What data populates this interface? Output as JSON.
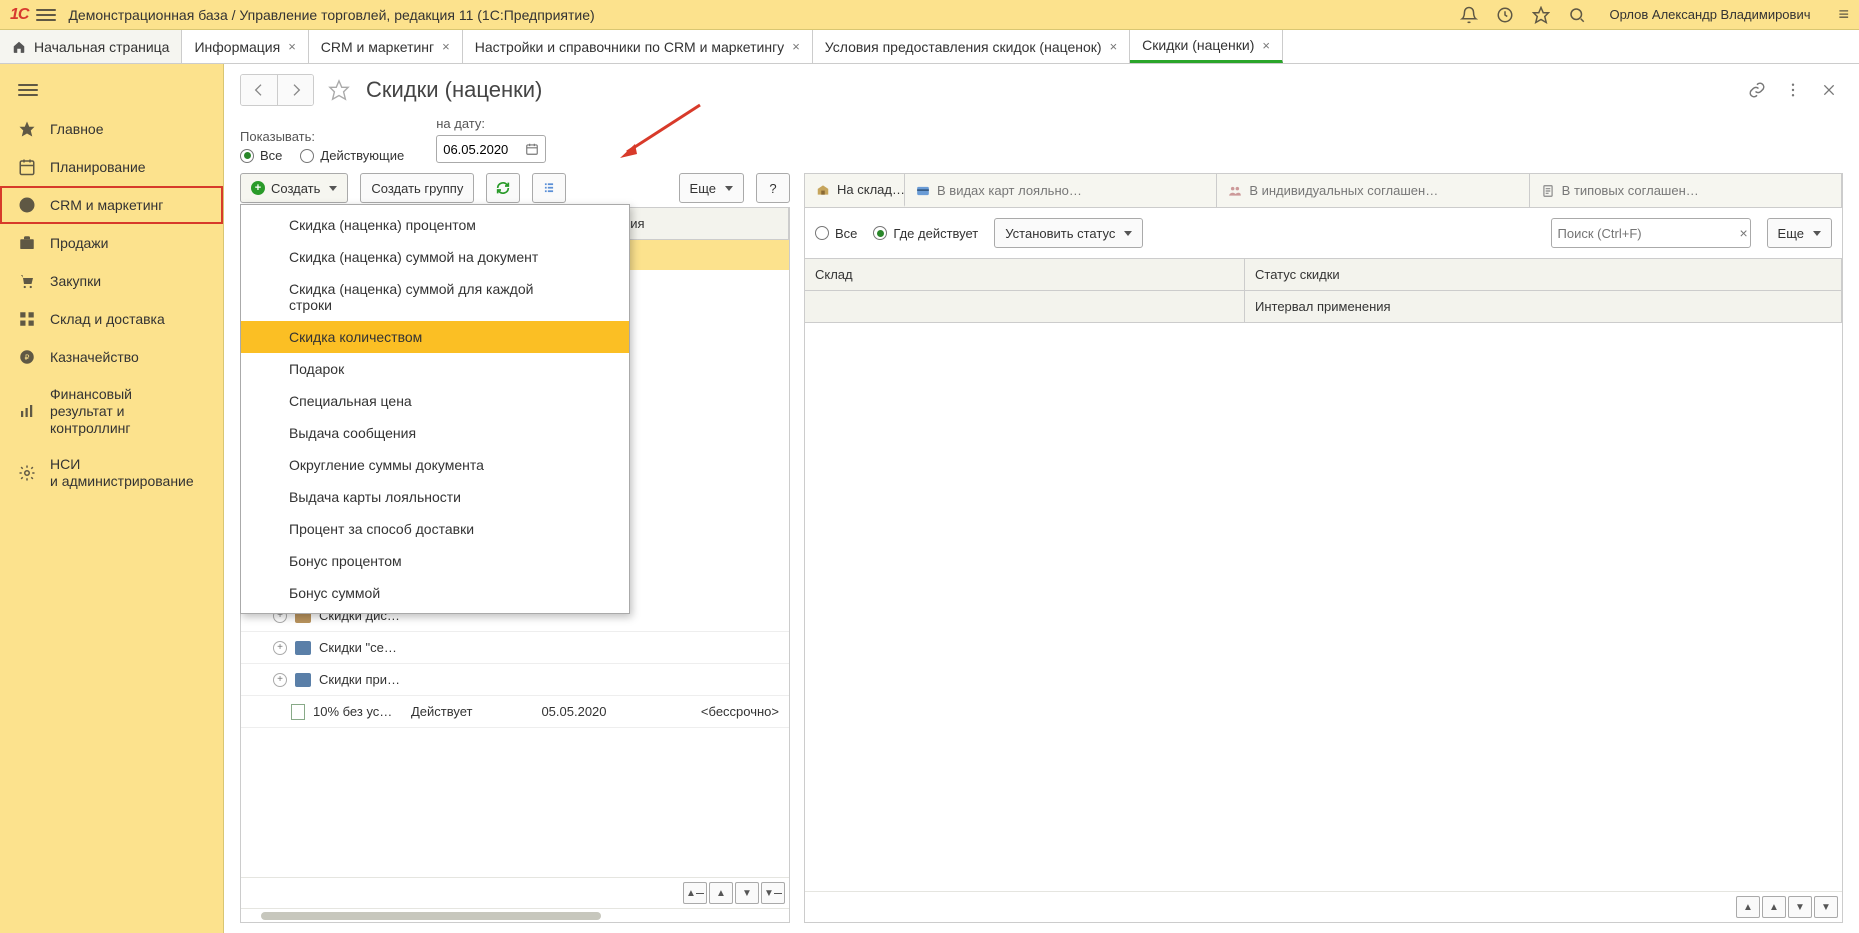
{
  "titlebar": {
    "app_title": "Демонстрационная база / Управление торговлей, редакция 11   (1С:Предприятие)",
    "user_name": "Орлов Александр Владимирович"
  },
  "tabs": [
    {
      "label": "Начальная страница",
      "closable": false,
      "active": false,
      "home": true
    },
    {
      "label": "Информация",
      "closable": true,
      "active": false
    },
    {
      "label": "CRM и маркетинг",
      "closable": true,
      "active": false
    },
    {
      "label": "Настройки и справочники по CRM и маркетингу",
      "closable": true,
      "active": false
    },
    {
      "label": "Условия предоставления скидок (наценок)",
      "closable": true,
      "active": false
    },
    {
      "label": "Скидки (наценки)",
      "closable": true,
      "active": true
    }
  ],
  "sidebar": {
    "hamburger": true,
    "items": [
      {
        "label": "Главное"
      },
      {
        "label": "Планирование"
      },
      {
        "label": "CRM и маркетинг",
        "highlighted": true
      },
      {
        "label": "Продажи"
      },
      {
        "label": "Закупки"
      },
      {
        "label": "Склад и доставка"
      },
      {
        "label": "Казначейство"
      },
      {
        "label": "Финансовый\nрезультат и контроллинг"
      },
      {
        "label": "НСИ\nи администрирование"
      }
    ]
  },
  "page": {
    "title": "Скидки (наценки)"
  },
  "filters": {
    "show_label": "Показывать:",
    "all": "Все",
    "active": "Действующие",
    "date_label": "на дату:",
    "date_value": "06.05.2020"
  },
  "toolbar": {
    "create": "Создать",
    "create_group": "Создать группу",
    "more": "Еще",
    "help": "?"
  },
  "create_menu": [
    "Скидка (наценка) процентом",
    "Скидка (наценка) суммой на документ",
    "Скидка (наценка) суммой для каждой строки",
    "Скидка количеством",
    "Подарок",
    "Специальная цена",
    "Выдача сообщения",
    "Округление суммы документа",
    "Выдача карты лояльности",
    "Процент за способ доставки",
    "Бонус процентом",
    "Бонус суммой"
  ],
  "create_menu_highlighted_index": 3,
  "left_table": {
    "headers": {
      "name_label_hidden": "",
      "period": "применения"
    },
    "tree": [
      {
        "name": "Скидки дис…"
      },
      {
        "name": "Скидки \"се…"
      },
      {
        "name": "Скидки при…"
      }
    ],
    "flat_row": {
      "name": "10% без ус…",
      "status": "Действует",
      "start": "05.05.2020",
      "end": "<бессрочно>"
    }
  },
  "right_pane": {
    "tabs": [
      {
        "label": "На склад…",
        "icon": "warehouse"
      },
      {
        "label": "В видах карт лояльно…",
        "icon": "card"
      },
      {
        "label": "В индивидуальных соглашен…",
        "icon": "people"
      },
      {
        "label": "В типовых соглашен…",
        "icon": "doc"
      }
    ],
    "filter": {
      "all": "Все",
      "where": "Где действует",
      "set_status": "Установить статус",
      "search_placeholder": "Поиск (Ctrl+F)",
      "more": "Еще"
    },
    "table": {
      "left_head": "Склад",
      "right_head_top": "Статус скидки",
      "right_head_sub": "Интервал применения"
    }
  }
}
